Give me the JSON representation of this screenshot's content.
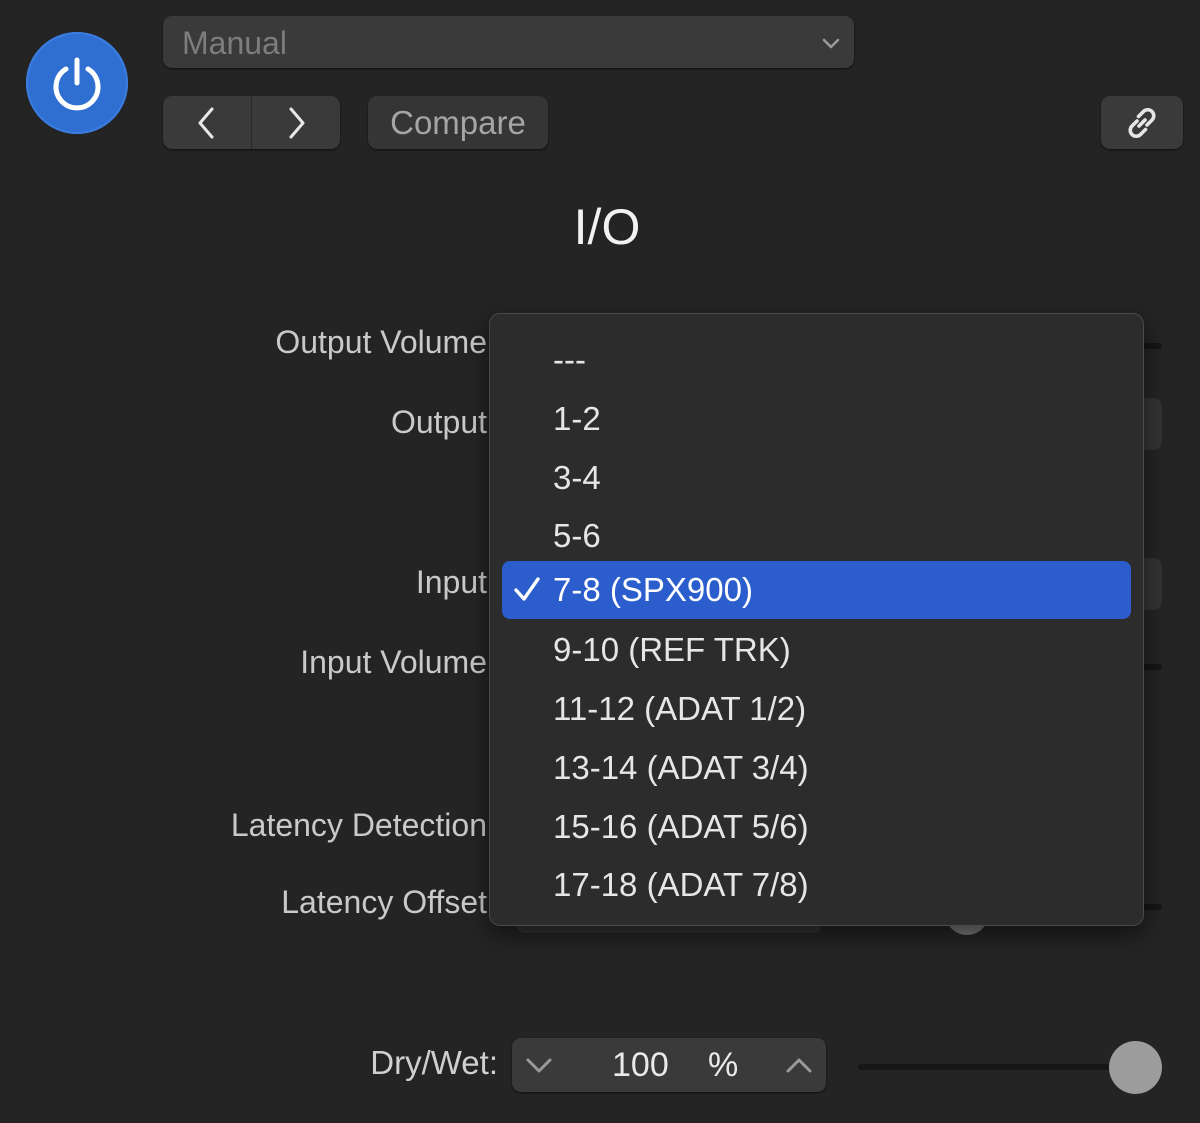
{
  "toolbar": {
    "power_icon": "power-icon",
    "preset": {
      "label": "Manual",
      "icon": "chevron-down-icon"
    },
    "prev_icon": "chevron-left-icon",
    "next_icon": "chevron-right-icon",
    "compare_label": "Compare",
    "link_icon": "link-icon"
  },
  "plugin": {
    "title": "I/O"
  },
  "params": {
    "output_volume": "Output Volume",
    "output": "Output",
    "input": "Input",
    "input_volume": "Input Volume",
    "latency_detection": "Latency Detection",
    "latency_offset": "Latency Offset"
  },
  "drywet": {
    "label": "Dry/Wet:",
    "value": "100",
    "unit": "%",
    "slider_fraction": 1.0
  },
  "menu": {
    "items": [
      {
        "label": "---",
        "selected": false
      },
      {
        "label": "1-2",
        "selected": false
      },
      {
        "label": "3-4",
        "selected": false
      },
      {
        "label": "5-6",
        "selected": false
      },
      {
        "label": "7-8 (SPX900)",
        "selected": true
      },
      {
        "label": "9-10 (REF TRK)",
        "selected": false
      },
      {
        "label": "11-12 (ADAT 1/2)",
        "selected": false
      },
      {
        "label": "13-14 (ADAT 3/4)",
        "selected": false
      },
      {
        "label": "15-16 (ADAT 5/6)",
        "selected": false
      },
      {
        "label": "17-18 (ADAT 7/8)",
        "selected": false
      }
    ],
    "selected_color": "#2c5dcc"
  },
  "colors": {
    "accent": "#2f6fd1",
    "background": "#242424"
  }
}
